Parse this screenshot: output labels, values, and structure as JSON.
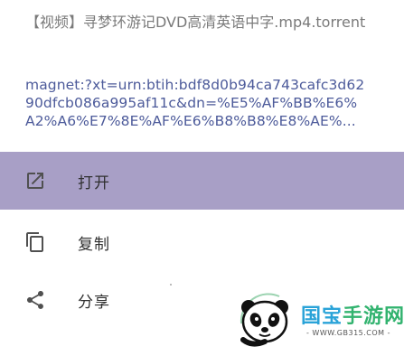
{
  "file_title": "【视频】寻梦环游记DVD高清英语中字.mp4.torrent",
  "magnet_lines": [
    "magnet:?xt=urn:btih:bdf8d0b94ca743cafc3d62",
    "90dfcb086a995af11c&dn=%E5%AF%BB%E6%",
    "A2%A6%E7%8E%AF%E6%B8%B8%E8%AE%..."
  ],
  "menu": {
    "open": {
      "label": "打开",
      "icon": "open-in-new-icon"
    },
    "copy": {
      "label": "复制",
      "icon": "copy-icon"
    },
    "share": {
      "label": "分享",
      "icon": "share-icon"
    }
  },
  "watermark": {
    "brand_part1": "国宝",
    "brand_part2": "手游网",
    "url": "- WWW.GB315.COM -"
  },
  "colors": {
    "highlight": "#a89fc6",
    "link_text": "#4c5a9a",
    "title_text": "#7a7a7a",
    "icon": "#505050"
  }
}
